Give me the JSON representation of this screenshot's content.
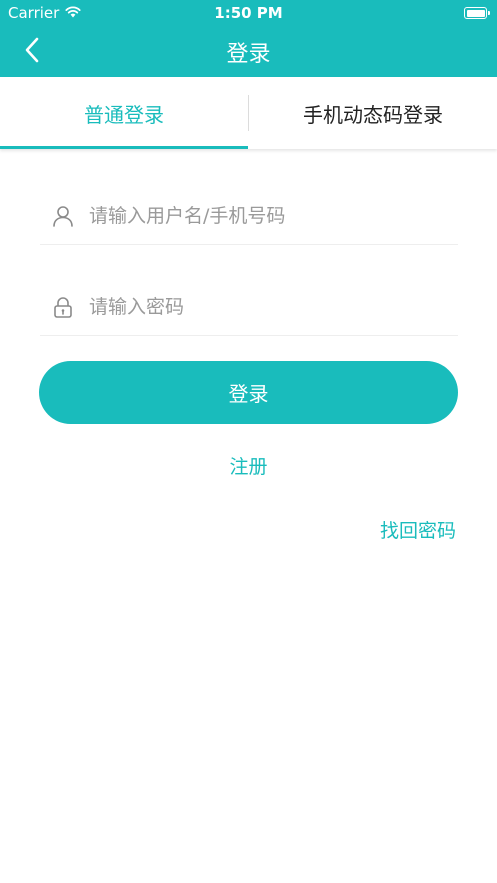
{
  "status_bar": {
    "carrier": "Carrier",
    "time": "1:50 PM",
    "wifi_icon": "wifi-icon",
    "battery_level": 1.0
  },
  "nav": {
    "title": "登录",
    "back_icon": "chevron-left-icon"
  },
  "tabs": [
    {
      "label": "普通登录",
      "active": true
    },
    {
      "label": "手机动态码登录",
      "active": false
    }
  ],
  "form": {
    "username_placeholder": "请输入用户名/手机号码",
    "username_value": "",
    "username_icon": "user-icon",
    "password_placeholder": "请输入密码",
    "password_value": "",
    "password_icon": "lock-icon"
  },
  "actions": {
    "login_label": "登录",
    "register_label": "注册",
    "forgot_label": "找回密码"
  },
  "colors": {
    "accent": "#19bcbc",
    "text": "#222222",
    "placeholder": "#9a9a9a"
  }
}
